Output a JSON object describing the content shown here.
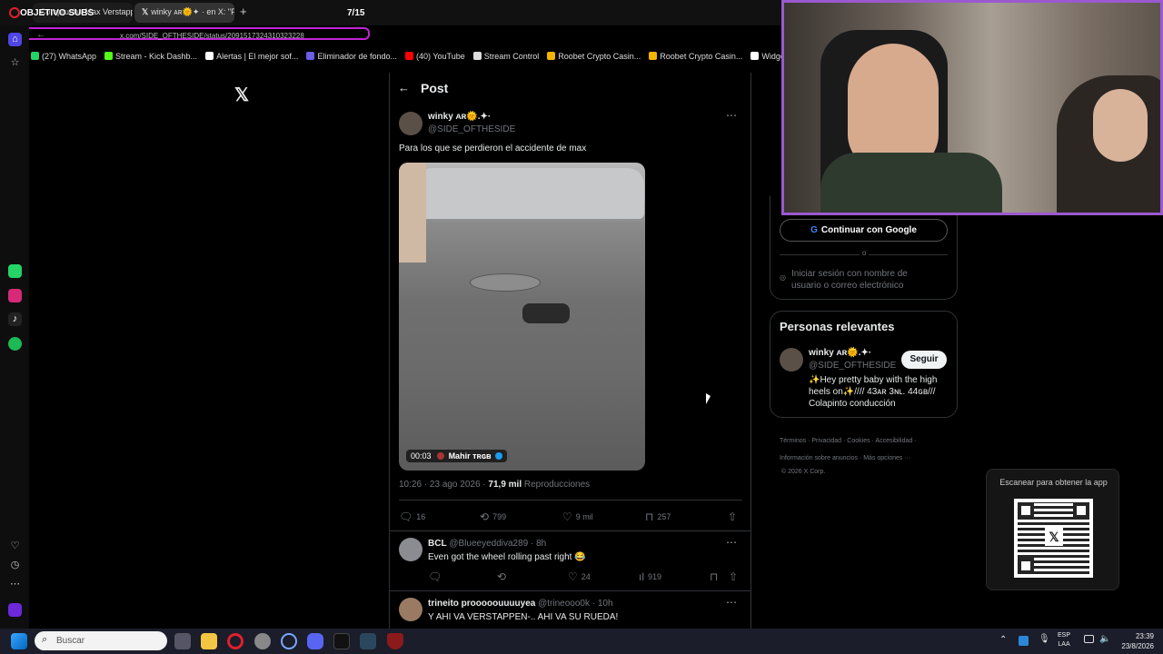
{
  "overlay": {
    "goal_label": "OBJETIVO SUBS",
    "counter": "7/15"
  },
  "tabs": [
    {
      "label": "Comprueba Max Verstappen X: \"Max Ver"
    },
    {
      "label": "winky ᴀʀ🌞✦ · en X: \"Par"
    }
  ],
  "address": {
    "url": "x.com/SIDE_OFTHESIDE/status/2091517324310323228"
  },
  "bookmarks": [
    {
      "label": "(27) WhatsApp",
      "color": "#25d366"
    },
    {
      "label": "Stream - Kick Dashb...",
      "color": "#53fc18"
    },
    {
      "label": "Alertas | El mejor sof...",
      "color": "#ffffff"
    },
    {
      "label": "Eliminador de fondo...",
      "color": "#6c5ce7"
    },
    {
      "label": "(40) YouTube",
      "color": "#ff0000"
    },
    {
      "label": "Stream Control",
      "color": "#dddddd"
    },
    {
      "label": "Roobet Crypto Casin...",
      "color": "#f5b400"
    },
    {
      "label": "Roobet Crypto Casin...",
      "color": "#f5b400"
    },
    {
      "label": "Widgets | El mejor s...",
      "color": "#ffffff"
    }
  ],
  "post": {
    "header_title": "Post",
    "author_name": "winky ᴀʀ🌞.✦·",
    "author_handle": "@SIDE_OFTHESIDE",
    "text": "Para los que se perdieron el accidente de max",
    "video_time": "00:03",
    "video_credit": "Mahir ᴛʀɢʙ",
    "timestamp": "10:26 · 23 ago 2026 · ",
    "views_count": "71,9 mil",
    "views_label": " Reproducciones",
    "replies": "16",
    "reposts": "799",
    "likes": "9 mil",
    "bookmarks": "257"
  },
  "replies": [
    {
      "name": "BCL",
      "handle": "@Blueeyeddiva289 · 8h",
      "text": "Even got the wheel rolling past right 😂",
      "replies": "",
      "reposts": "",
      "likes": "24",
      "views": "919"
    },
    {
      "name": "trineito prooooouuuuyea",
      "handle": "@trineooo0k · 10h",
      "text": "Y AHI VA VERSTAPPEN-.. AHI VA SU RUEDA!"
    }
  ],
  "sidebar": {
    "google_button": "Continuar con Google",
    "or_label": "o",
    "signin_text": "Iniciar sesión con nombre de usuario o correo electrónico",
    "relevant_title": "Personas relevantes",
    "person_name": "winky ᴀʀ🌞.✦·",
    "person_handle": "@SIDE_OFTHESIDE",
    "follow_label": "Seguir",
    "person_bio": "✨Hey pretty baby with the high heels on✨//// 43ᴀʀ 3ɴʟ. 44ɢʙ/// Colapinto conducción",
    "footer_line1": "Términos · Privacidad · Cookies · Accesibilidad ·",
    "footer_line2": "Información sobre anuncios · Más opciones ···",
    "footer_line3": "© 2026 X Corp."
  },
  "qr": {
    "label": "Escanear para obtener la app"
  },
  "taskbar": {
    "search_placeholder": "Buscar",
    "lang_top": "ESP",
    "lang_bottom": "LAA",
    "time": "23:39",
    "date": "23/8/2026"
  },
  "colors": {
    "accent_purple": "#9b59d0",
    "url_outline": "#c026d3",
    "x_bg": "#000000",
    "verified": "#1d9bf0"
  }
}
